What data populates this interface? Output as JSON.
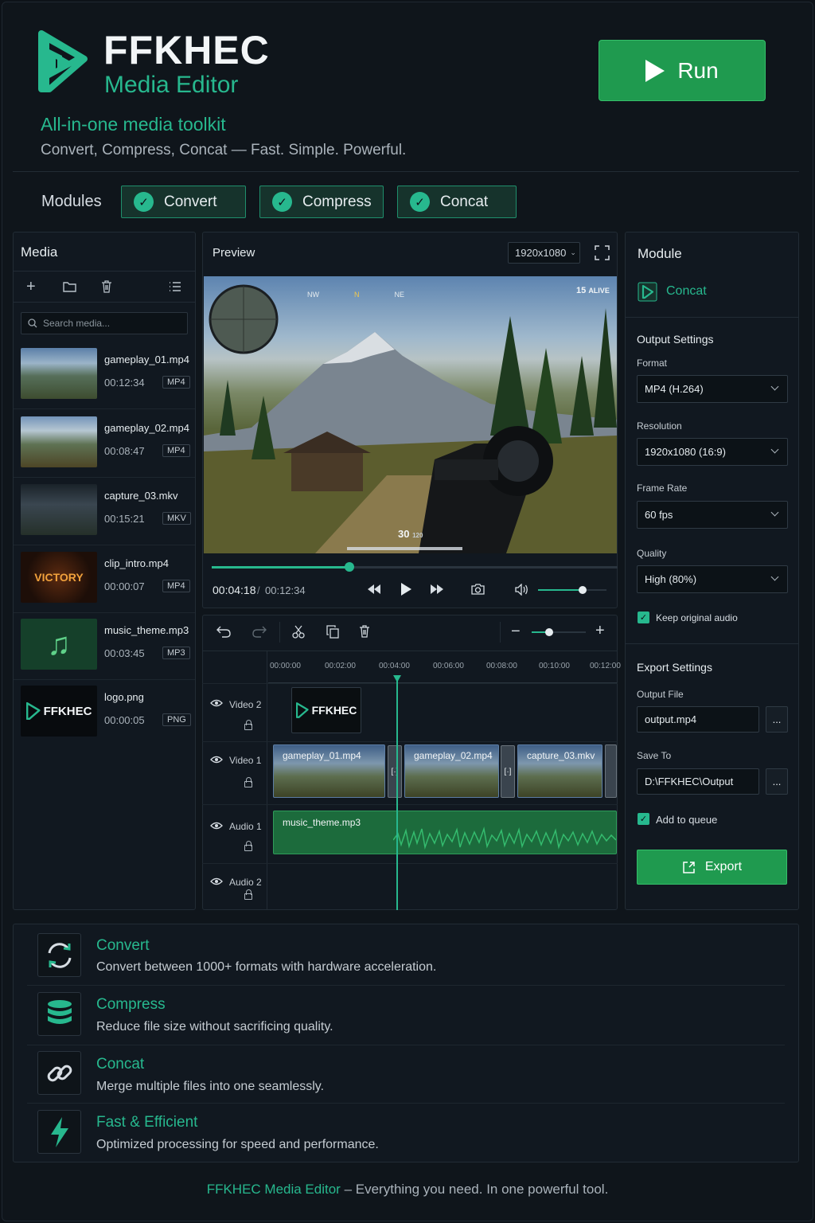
{
  "app": {
    "title": "FFKHEC",
    "subtitle": "Media Editor",
    "tagline": "All-in-one media toolkit",
    "tagline_sub": "Convert, Compress, Concat — Fast. Simple. Powerful.",
    "run_label": "Run"
  },
  "modules": {
    "label": "Modules",
    "items": [
      {
        "label": "Convert"
      },
      {
        "label": "Compress"
      },
      {
        "label": "Concat"
      }
    ]
  },
  "media": {
    "title": "Media",
    "search_placeholder": "Search media...",
    "items": [
      {
        "name": "gameplay_01.mp4",
        "duration": "00:12:34",
        "type": "MP4"
      },
      {
        "name": "gameplay_02.mp4",
        "duration": "00:08:47",
        "type": "MP4"
      },
      {
        "name": "capture_03.mkv",
        "duration": "00:15:21",
        "type": "MKV"
      },
      {
        "name": "clip_intro.mp4",
        "duration": "00:00:07",
        "type": "MP4",
        "thumb_text": "VICTORY"
      },
      {
        "name": "music_theme.mp3",
        "duration": "00:03:45",
        "type": "MP3"
      },
      {
        "name": "logo.png",
        "duration": "00:00:05",
        "type": "PNG",
        "thumb_text": "FFKHEC"
      }
    ]
  },
  "preview": {
    "title": "Preview",
    "resolution": "1920x1080",
    "current_time": "00:04:18",
    "separator": "/",
    "total_time": "00:12:34",
    "progress": 0.34,
    "volume": 0.65,
    "hud": {
      "alive": "15",
      "alive_label": "ALIVE",
      "compass": [
        "NW",
        "N",
        "NE"
      ],
      "ammo": "30",
      "ammo_reserve": "120"
    }
  },
  "timeline": {
    "ticks": [
      "00:00:00",
      "00:02:00",
      "00:04:00",
      "00:06:00",
      "00:08:00",
      "00:10:00",
      "00:12:00"
    ],
    "tracks": [
      {
        "label": "Video 2"
      },
      {
        "label": "Video 1"
      },
      {
        "label": "Audio 1"
      },
      {
        "label": "Audio 2"
      }
    ],
    "clips": {
      "logo": "FFKHEC",
      "v1": [
        "gameplay_01.mp4",
        "gameplay_02.mp4",
        "capture_03.mkv"
      ],
      "audio": "music_theme.mp3"
    },
    "zoom": 0.33
  },
  "module_panel": {
    "title": "Module",
    "active_module": "Concat",
    "output_settings": {
      "title": "Output Settings",
      "format_label": "Format",
      "format_value": "MP4 (H.264)",
      "resolution_label": "Resolution",
      "resolution_value": "1920x1080 (16:9)",
      "framerate_label": "Frame Rate",
      "framerate_value": "60 fps",
      "quality_label": "Quality",
      "quality_value": "High (80%)",
      "keep_audio_label": "Keep original audio"
    },
    "export_settings": {
      "title": "Export Settings",
      "output_file_label": "Output File",
      "output_file_value": "output.mp4",
      "save_to_label": "Save To",
      "save_to_value": "D:\\FFKHEC\\Output",
      "browse_label": "...",
      "add_queue_label": "Add to queue",
      "export_label": "Export"
    }
  },
  "features": [
    {
      "title": "Convert",
      "desc": "Convert between 1000+ formats with hardware acceleration."
    },
    {
      "title": "Compress",
      "desc": "Reduce file size without sacrificing quality."
    },
    {
      "title": "Concat",
      "desc": "Merge multiple files into one seamlessly."
    },
    {
      "title": "Fast & Efficient",
      "desc": "Optimized processing for speed and performance."
    }
  ],
  "footer": {
    "brand": "FFKHEC Media Editor",
    "text": " – Everything you need. In one powerful tool."
  },
  "colors": {
    "accent": "#27b88e",
    "run_green": "#1f9a4f",
    "background": "#0f151b"
  }
}
